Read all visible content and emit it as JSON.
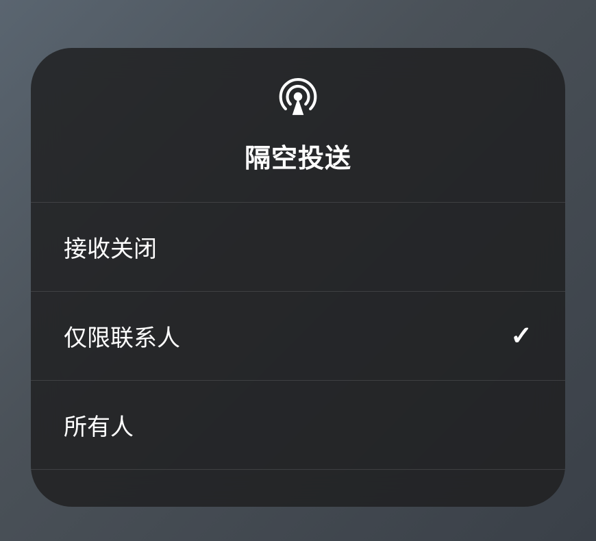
{
  "panel": {
    "title": "隔空投送",
    "icon": "airdrop-icon"
  },
  "options": [
    {
      "label": "接收关闭",
      "selected": false
    },
    {
      "label": "仅限联系人",
      "selected": true
    },
    {
      "label": "所有人",
      "selected": false
    }
  ]
}
